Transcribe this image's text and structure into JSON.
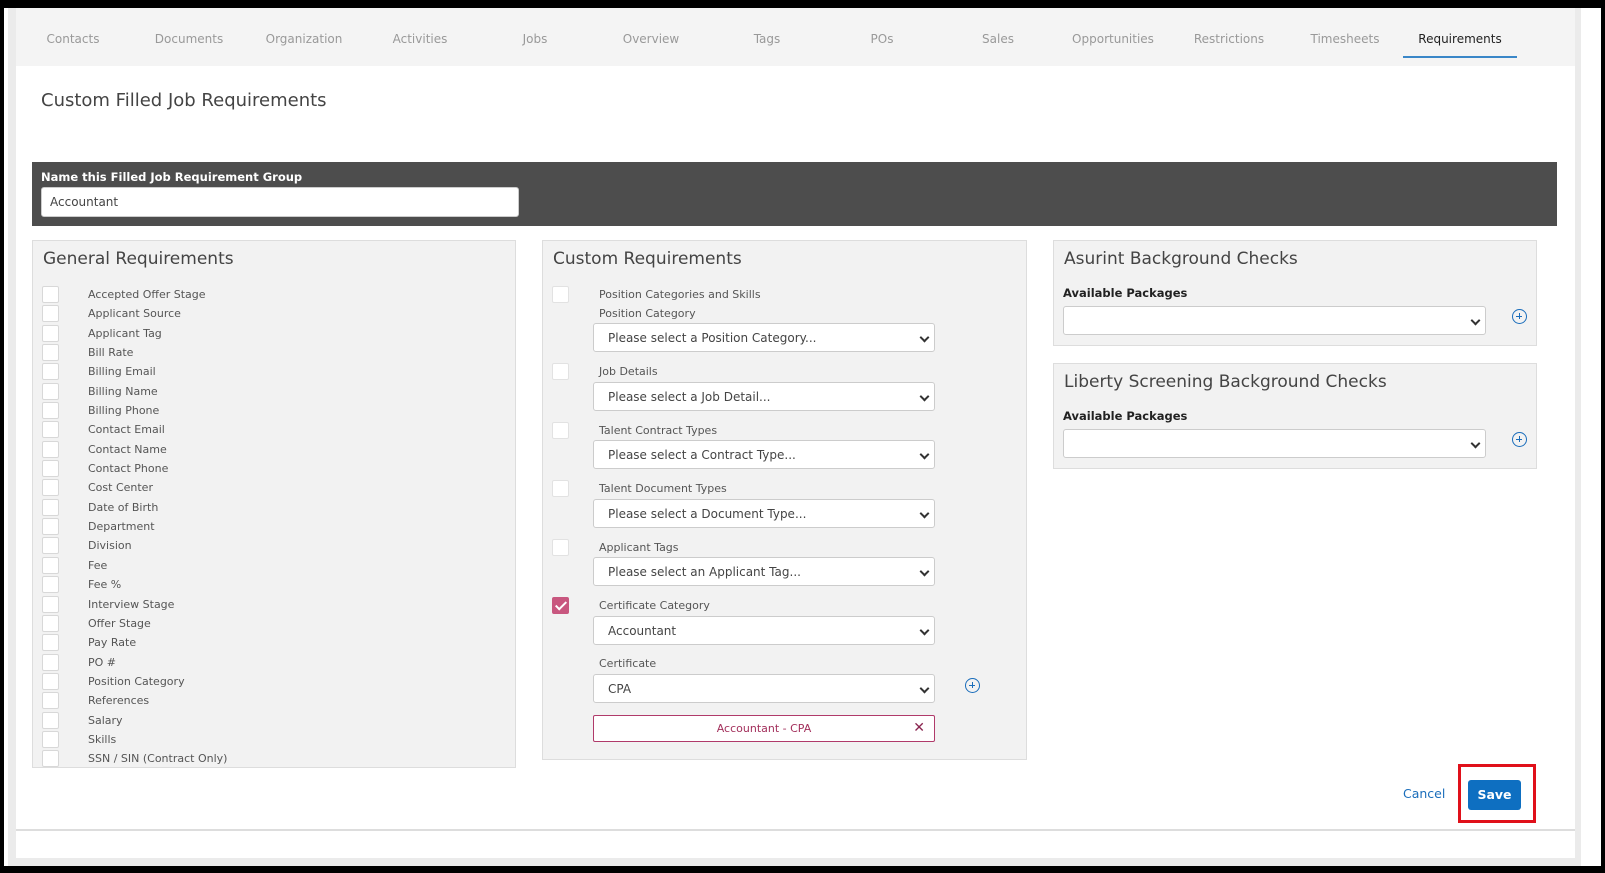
{
  "tabs": [
    "Contacts",
    "Documents",
    "Organization",
    "Activities",
    "Jobs",
    "Overview",
    "Tags",
    "POs",
    "Sales",
    "Opportunities",
    "Restrictions",
    "Timesheets",
    "Requirements"
  ],
  "active_tab": "Requirements",
  "page_title": "Custom Filled Job Requirements",
  "group_name": {
    "label": "Name this Filled Job Requirement Group",
    "value": "Accountant"
  },
  "general": {
    "title": "General Requirements",
    "items": [
      "Accepted Offer Stage",
      "Applicant Source",
      "Applicant Tag",
      "Bill Rate",
      "Billing Email",
      "Billing Name",
      "Billing Phone",
      "Contact Email",
      "Contact Name",
      "Contact Phone",
      "Cost Center",
      "Date of Birth",
      "Department",
      "Division",
      "Fee",
      "Fee %",
      "Interview Stage",
      "Offer Stage",
      "Pay Rate",
      "PO #",
      "Position Category",
      "References",
      "Salary",
      "Skills",
      "SSN / SIN (Contract Only)"
    ]
  },
  "custom": {
    "title": "Custom Requirements",
    "position_label": "Position Categories and Skills",
    "position_sublabel": "Position Category",
    "position_select": "Please select a Position Category...",
    "job_details_label": "Job Details",
    "job_details_select": "Please select a Job Detail...",
    "contract_label": "Talent Contract Types",
    "contract_select": "Please select a Contract Type...",
    "document_label": "Talent Document Types",
    "document_select": "Please select a Document Type...",
    "tags_label": "Applicant Tags",
    "tags_select": "Please select an Applicant Tag...",
    "cert_cat_label": "Certificate Category",
    "cert_cat_select": "Accountant",
    "cert_label": "Certificate",
    "cert_select": "CPA",
    "chip": "Accountant - CPA",
    "chip_remove": "✕"
  },
  "asurint": {
    "title": "Asurint Background Checks",
    "packages_label": "Available Packages",
    "packages_value": ""
  },
  "liberty": {
    "title": "Liberty Screening Background Checks",
    "packages_label": "Available Packages",
    "packages_value": ""
  },
  "actions": {
    "cancel": "Cancel",
    "save": "Save"
  },
  "colors": {
    "accent": "#0e6fc1",
    "checkbox_checked": "#c8577f",
    "highlight_box": "#e0101a"
  }
}
